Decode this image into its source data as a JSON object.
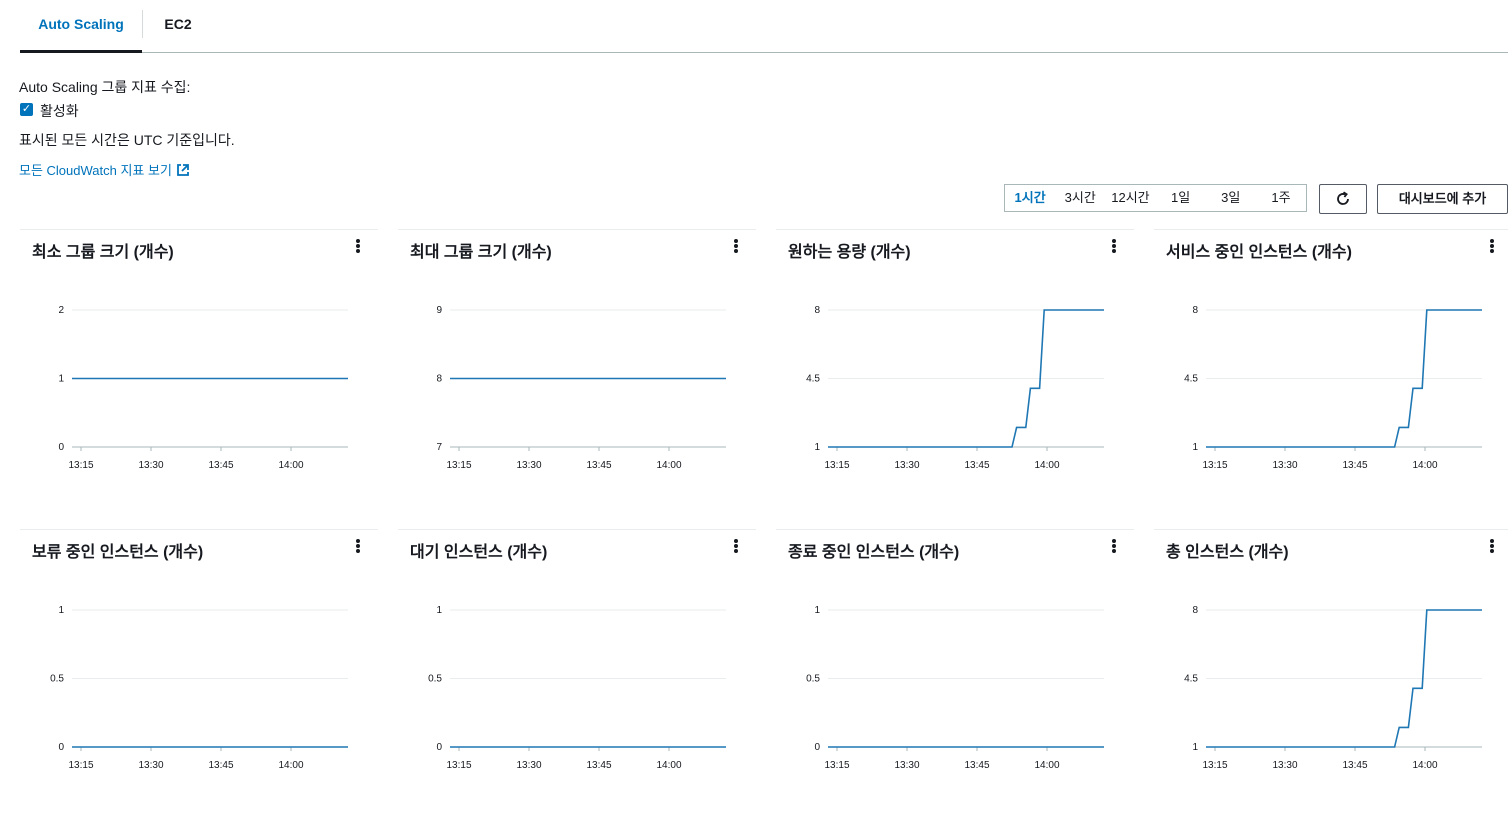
{
  "tabs": [
    {
      "label": "Auto Scaling",
      "active": true
    },
    {
      "label": "EC2",
      "active": false
    }
  ],
  "collection_label": "Auto Scaling 그룹 지표 수집:",
  "enabled_label": "활성화",
  "utc_note": "표시된 모든 시간은 UTC 기준입니다.",
  "cloudwatch_link": "모든 CloudWatch 지표 보기",
  "time_ranges": [
    {
      "label": "1시간",
      "active": true
    },
    {
      "label": "3시간",
      "active": false
    },
    {
      "label": "12시간",
      "active": false
    },
    {
      "label": "1일",
      "active": false
    },
    {
      "label": "3일",
      "active": false
    },
    {
      "label": "1주",
      "active": false
    }
  ],
  "add_dashboard_label": "대시보드에 추가",
  "colors": {
    "accent": "#0073bb",
    "line": "#1f77b4"
  },
  "chart_data": [
    {
      "type": "line",
      "title": "최소 그룹 크기 (개수)",
      "yticks": [
        "0",
        "1",
        "2"
      ],
      "ylim": [
        0,
        2
      ],
      "xticks": [
        "13:15",
        "13:30",
        "13:45",
        "14:00"
      ],
      "x": [
        0,
        60
      ],
      "y": [
        1,
        1
      ]
    },
    {
      "type": "line",
      "title": "최대 그룹 크기 (개수)",
      "yticks": [
        "7",
        "8",
        "9"
      ],
      "ylim": [
        7,
        9
      ],
      "xticks": [
        "13:15",
        "13:30",
        "13:45",
        "14:00"
      ],
      "x": [
        0,
        60
      ],
      "y": [
        8,
        8
      ]
    },
    {
      "type": "line",
      "title": "원하는 용량 (개수)",
      "yticks": [
        "1",
        "4.5",
        "8"
      ],
      "ylim": [
        1,
        8
      ],
      "xticks": [
        "13:15",
        "13:30",
        "13:45",
        "14:00"
      ],
      "x": [
        0,
        40,
        41,
        43,
        44,
        46,
        47,
        60
      ],
      "y": [
        1,
        1,
        2,
        2,
        4,
        4,
        8,
        8
      ]
    },
    {
      "type": "line",
      "title": "서비스 중인 인스턴스 (개수)",
      "yticks": [
        "1",
        "4.5",
        "8"
      ],
      "ylim": [
        1,
        8
      ],
      "xticks": [
        "13:15",
        "13:30",
        "13:45",
        "14:00"
      ],
      "x": [
        0,
        41,
        42,
        44,
        45,
        47,
        48,
        60
      ],
      "y": [
        1,
        1,
        2,
        2,
        4,
        4,
        8,
        8
      ]
    },
    {
      "type": "line",
      "title": "보류 중인 인스턴스 (개수)",
      "yticks": [
        "0",
        "0.5",
        "1"
      ],
      "ylim": [
        0,
        1
      ],
      "xticks": [
        "13:15",
        "13:30",
        "13:45",
        "14:00"
      ],
      "x": [
        0,
        60
      ],
      "y": [
        0,
        0
      ]
    },
    {
      "type": "line",
      "title": "대기 인스턴스 (개수)",
      "yticks": [
        "0",
        "0.5",
        "1"
      ],
      "ylim": [
        0,
        1
      ],
      "xticks": [
        "13:15",
        "13:30",
        "13:45",
        "14:00"
      ],
      "x": [
        0,
        60
      ],
      "y": [
        0,
        0
      ]
    },
    {
      "type": "line",
      "title": "종료 중인 인스턴스 (개수)",
      "yticks": [
        "0",
        "0.5",
        "1"
      ],
      "ylim": [
        0,
        1
      ],
      "xticks": [
        "13:15",
        "13:30",
        "13:45",
        "14:00"
      ],
      "x": [
        0,
        60
      ],
      "y": [
        0,
        0
      ]
    },
    {
      "type": "line",
      "title": "총 인스턴스 (개수)",
      "yticks": [
        "1",
        "4.5",
        "8"
      ],
      "ylim": [
        1,
        8
      ],
      "xticks": [
        "13:15",
        "13:30",
        "13:45",
        "14:00"
      ],
      "x": [
        0,
        41,
        42,
        44,
        45,
        47,
        48,
        60
      ],
      "y": [
        1,
        1,
        2,
        2,
        4,
        4,
        8,
        8
      ]
    }
  ]
}
